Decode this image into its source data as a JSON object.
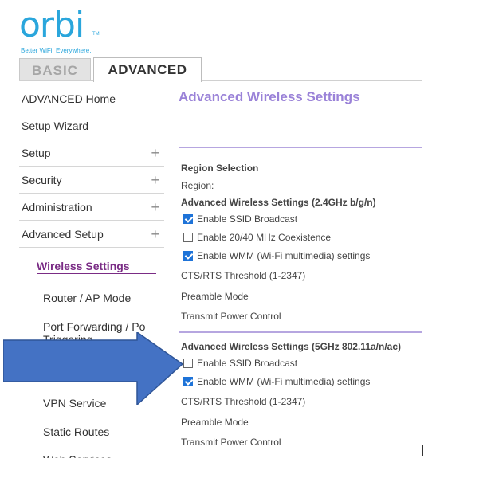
{
  "logo": {
    "text": "orbi",
    "tm": "TM",
    "tagline": "Better WiFi. Everywhere."
  },
  "tabs": {
    "basic": "BASIC",
    "advanced": "ADVANCED"
  },
  "sidebar": {
    "items": [
      {
        "label": "ADVANCED Home"
      },
      {
        "label": "Setup Wizard"
      },
      {
        "label": "Setup",
        "plus": "+"
      },
      {
        "label": "Security",
        "plus": "+"
      },
      {
        "label": "Administration",
        "plus": "+"
      },
      {
        "label": "Advanced Setup",
        "plus": "+"
      }
    ],
    "sub_items": [
      {
        "label": "Wireless Settings"
      },
      {
        "label": "Router / AP Mode"
      },
      {
        "label": "Port Forwarding / Port Triggering",
        "line1": "Port Forwarding / Po",
        "line2": "Triggering"
      },
      {
        "label": "VPN Service"
      },
      {
        "label": "Static Routes"
      },
      {
        "label": "Web Services"
      }
    ]
  },
  "main": {
    "title": "Advanced Wireless Settings",
    "region_selection": "Region Selection",
    "region_label": "Region:",
    "section_24": "Advanced Wireless Settings (2.4GHz b/g/n)",
    "opts_24": [
      {
        "label": "Enable SSID Broadcast",
        "checked": true
      },
      {
        "label": "Enable 20/40 MHz Coexistence",
        "checked": false
      },
      {
        "label": "Enable WMM (Wi-Fi multimedia) settings",
        "checked": true
      }
    ],
    "cts_24": "CTS/RTS Threshold (1-2347)",
    "preamble_24": "Preamble Mode",
    "power_24": "Transmit Power Control",
    "section_5": "Advanced Wireless Settings (5GHz 802.11a/n/ac)",
    "opts_5": [
      {
        "label": "Enable SSID Broadcast",
        "checked": false
      },
      {
        "label": "Enable WMM (Wi-Fi multimedia) settings",
        "checked": true
      }
    ],
    "cts_5": "CTS/RTS Threshold (1-2347)",
    "preamble_5": "Preamble Mode",
    "power_5": "Transmit Power Control"
  },
  "colors": {
    "brand": "#2aa6dc",
    "accent": "#9a82d8",
    "active_nav": "#7a2c85",
    "checkbox": "#1e73d8",
    "arrow": "#4472c4"
  },
  "icons": {
    "plus": "plus-icon",
    "arrow": "arrow-right-icon",
    "checkbox": "checkbox-icon"
  }
}
